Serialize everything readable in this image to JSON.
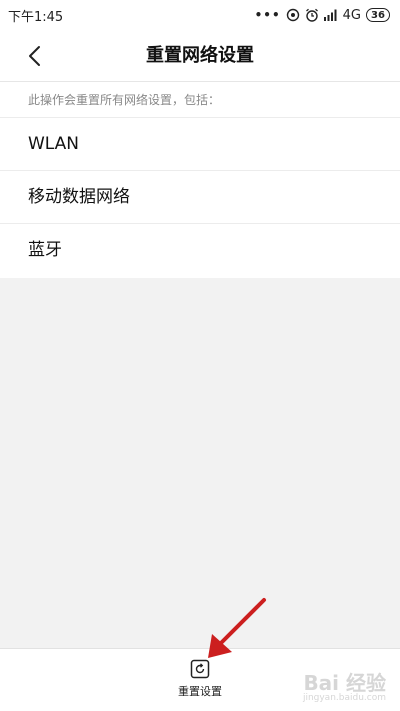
{
  "status_bar": {
    "time": "下午1:45",
    "network": "4G",
    "battery": "36",
    "icons": [
      "more-dots-icon",
      "hotspot-icon",
      "alarm-icon",
      "signal-icon",
      "battery-icon"
    ]
  },
  "header": {
    "title": "重置网络设置",
    "back_icon": "chevron-left-icon"
  },
  "content": {
    "description": "此操作会重置所有网络设置，包括：",
    "items": [
      {
        "label": "WLAN"
      },
      {
        "label": "移动数据网络"
      },
      {
        "label": "蓝牙"
      }
    ]
  },
  "bottom_bar": {
    "reset_label": "重置设置",
    "reset_icon": "reset-icon"
  },
  "annotation": {
    "arrow_color": "#cc1f1f"
  },
  "watermark": {
    "text": "Bai 经验",
    "url": "jingyan.baidu.com"
  },
  "colors": {
    "background": "#f2f2f2",
    "surface": "#ffffff",
    "text_primary": "#111111",
    "text_secondary": "#888888",
    "divider": "#ececec"
  }
}
